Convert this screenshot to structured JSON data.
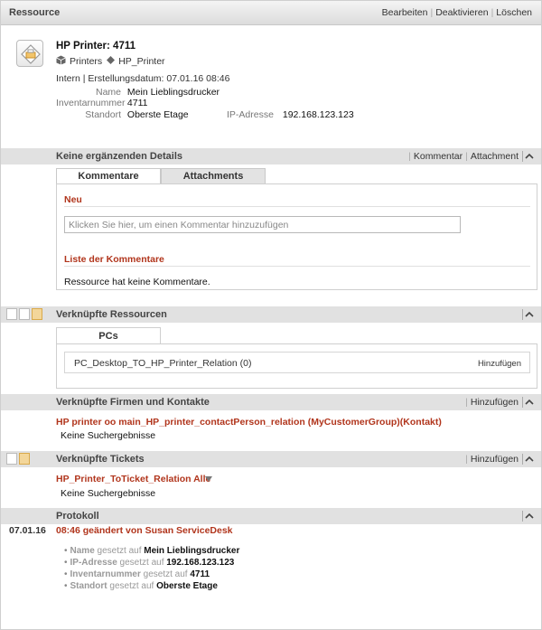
{
  "header": {
    "title": "Ressource",
    "actions": {
      "edit": "Bearbeiten",
      "deactivate": "Deaktivieren",
      "delete": "Löschen"
    }
  },
  "resource": {
    "name": "HP Printer: 4711",
    "breadcrumb": {
      "category": "Printers",
      "type": "HP_Printer"
    },
    "meta": "Intern | Erstellungsdatum: 07.01.16 08:46",
    "fields": {
      "name_label": "Name",
      "name_value": "Mein Lieblingsdrucker",
      "inventory_label": "Inventarnummer",
      "inventory_value": "4711",
      "location_label": "Standort",
      "location_value": "Oberste Etage",
      "ip_label": "IP-Adresse",
      "ip_value": "192.168.123.123"
    }
  },
  "details": {
    "title": "Keine ergänzenden Details",
    "actions": {
      "comment": "Kommentar",
      "attachment": "Attachment"
    },
    "tabs": [
      {
        "label": "Kommentare"
      },
      {
        "label": "Attachments"
      }
    ],
    "new_heading": "Neu",
    "comment_placeholder": "Klicken Sie hier, um einen Kommentar hinzuzufügen",
    "list_heading": "Liste der Kommentare",
    "empty_text": "Ressource hat keine Kommentare."
  },
  "linked_resources": {
    "title": "Verknüpfte Ressourcen",
    "tab": "PCs",
    "relation": "PC_Desktop_TO_HP_Printer_Relation (0)",
    "add": "Hinzufügen"
  },
  "linked_companies": {
    "title": "Verknüpfte Firmen und Kontakte",
    "add": "Hinzufügen",
    "relation": "HP printer oo main_HP_printer_contactPerson_relation (MyCustomerGroup)(Kontakt)",
    "empty": "Keine Suchergebnisse"
  },
  "linked_tickets": {
    "title": "Verknüpfte Tickets",
    "add": "Hinzufügen",
    "relation": "HP_Printer_ToTicket_Relation Alle",
    "empty": "Keine Suchergebnisse"
  },
  "protocol": {
    "title": "Protokoll",
    "date": "07.01.16",
    "entry": "08:46 geändert von Susan ServiceDesk",
    "set_word": "gesetzt auf",
    "changes": [
      {
        "field": "Name",
        "value": "Mein Lieblingsdrucker"
      },
      {
        "field": "IP-Adresse",
        "value": "192.168.123.123"
      },
      {
        "field": "Inventarnummer",
        "value": "4711"
      },
      {
        "field": "Standort",
        "value": "Oberste Etage"
      }
    ]
  },
  "colors": {
    "accent_red": "#b1351c",
    "section_bar": "#e1e1e1",
    "header_bar": "#dcdcdc"
  }
}
